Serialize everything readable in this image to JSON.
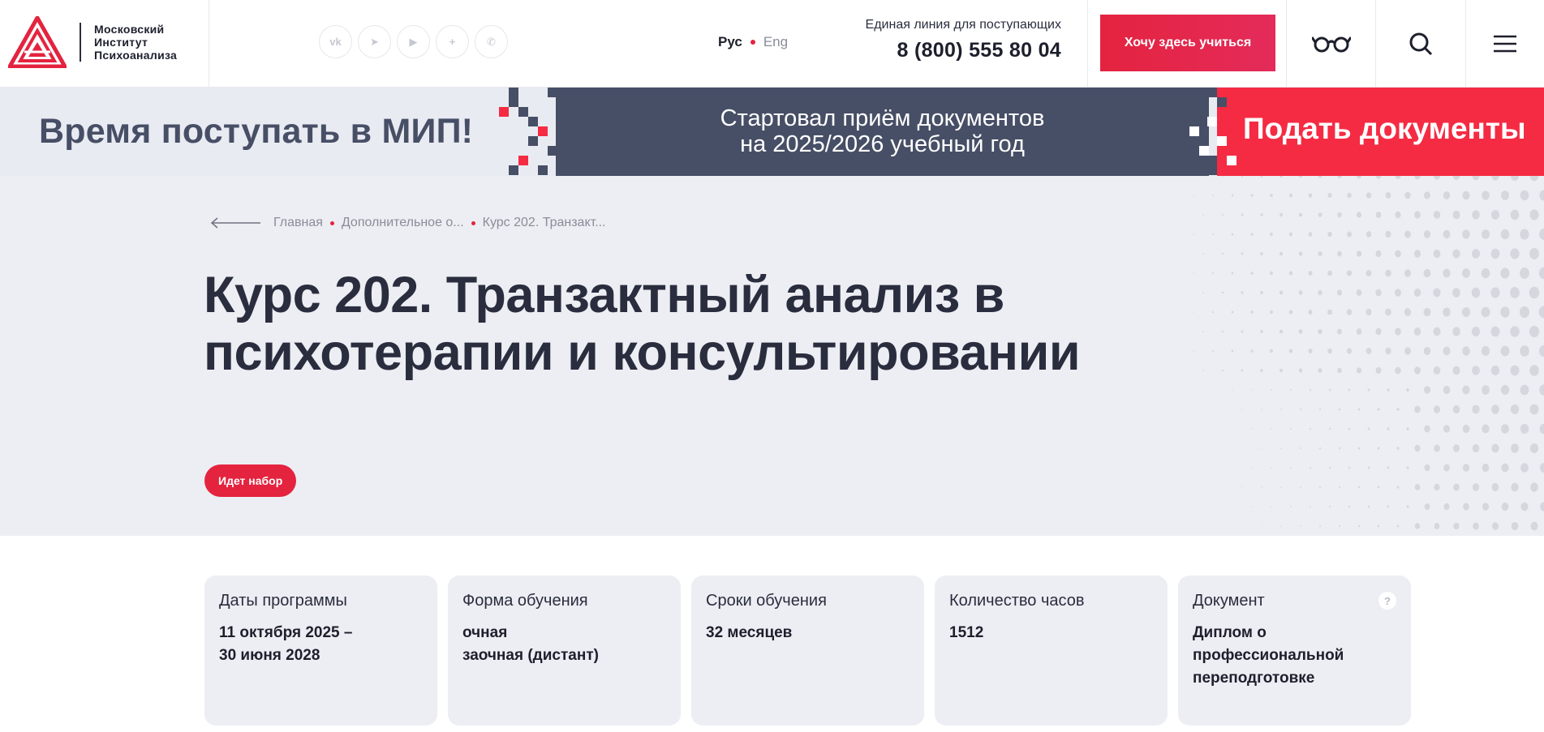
{
  "header": {
    "logo_lines": [
      "Московский",
      "Институт",
      "Психоанализа"
    ],
    "socials": [
      {
        "icon": "vk-icon",
        "glyph": "vk"
      },
      {
        "icon": "telegram-icon",
        "glyph": "➤"
      },
      {
        "icon": "youtube-icon",
        "glyph": "▶"
      },
      {
        "icon": "plus-icon",
        "glyph": "+"
      },
      {
        "icon": "whatsapp-icon",
        "glyph": "✆"
      }
    ],
    "lang_ru": "Рус",
    "lang_en": "Eng",
    "hotline_label": "Единая линия для поступающих",
    "phone": "8 (800) 555 80 04",
    "cta": "Хочу здесь учиться",
    "accent": "#e4233f"
  },
  "promo": {
    "left": "Время поступать в МИП!",
    "mid_line1": "Стартовал приём документов",
    "mid_line2": "на 2025/2026 учебный год",
    "right": "Подать документы"
  },
  "breadcrumbs": [
    "Главная",
    "Дополнительное о...",
    "Курс 202. Транзакт..."
  ],
  "hero": {
    "title_line1": "Курс 202. Транзактный анализ в",
    "title_line2": "психотерапии и консультировании",
    "badge": "Идет набор"
  },
  "cards": [
    {
      "label": "Даты программы",
      "value": "11 октября 2025 –\n30 июня 2028"
    },
    {
      "label": "Форма обучения",
      "value": "очная\nзаочная (дистант)"
    },
    {
      "label": "Сроки обучения",
      "value": "32 месяцев"
    },
    {
      "label": "Количество часов",
      "value": "1512"
    },
    {
      "label": "Документ",
      "value": "Диплом о\nпрофессиональной\nпереподготовке",
      "help": "?"
    }
  ]
}
